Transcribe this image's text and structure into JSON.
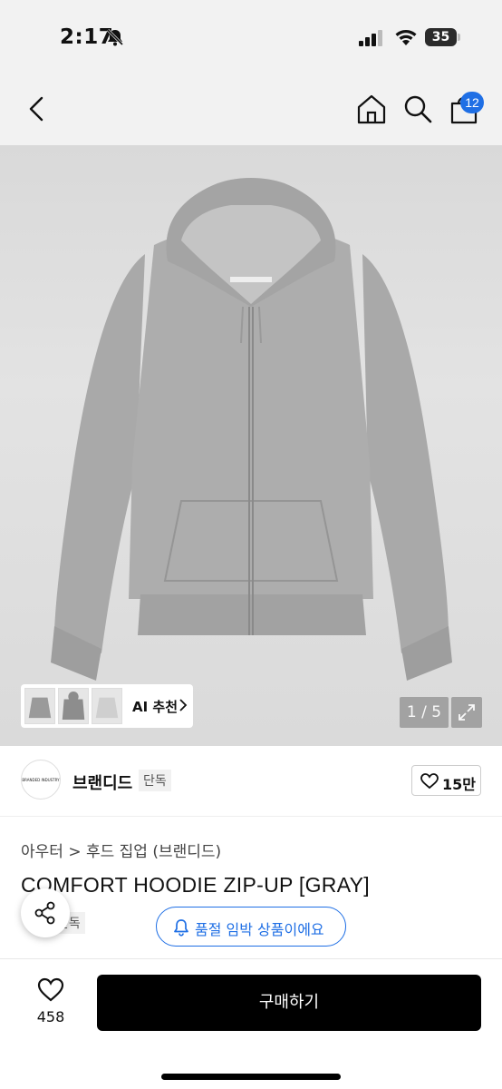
{
  "status_bar": {
    "time": "2:17",
    "battery": "35"
  },
  "nav": {
    "cart_count": "12"
  },
  "gallery": {
    "ai_label": "AI 추천",
    "page_counter": "1 / 5"
  },
  "brand": {
    "logo_text": "BRANDED INDUSTRY",
    "name": "브랜디드",
    "tag": "단독",
    "likes": "15만"
  },
  "product": {
    "category": "아우터 > 후드 집업 (브랜디드)",
    "title": "COMFORT HOODIE ZIP-UP [GRAY]",
    "exclusive_tag": "단독",
    "stock_notice": "품절 임박 상품이에요"
  },
  "bottom": {
    "wish_count": "458",
    "buy_label": "구매하기"
  },
  "colors": {
    "accent": "#1f6fe5",
    "buy_button": "#000000",
    "hoodie": "#a8a8a8"
  }
}
